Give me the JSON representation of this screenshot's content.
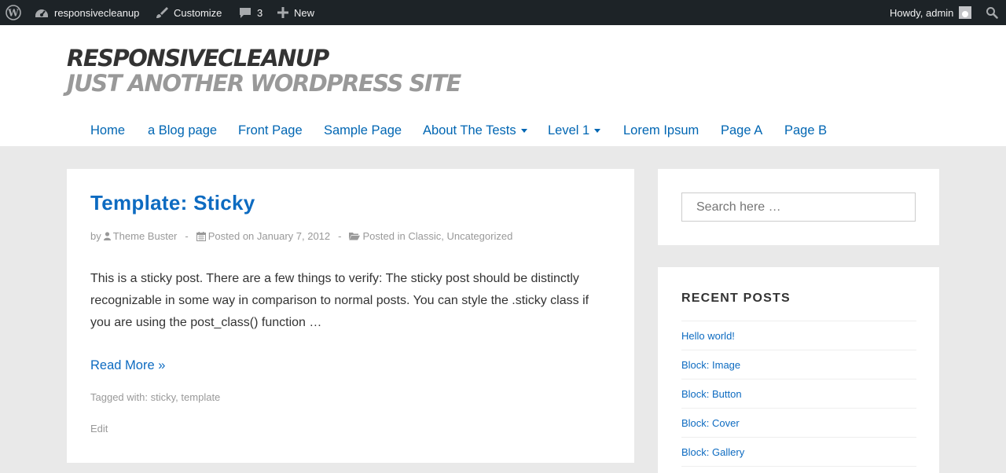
{
  "admin_bar": {
    "site_name": "responsivecleanup",
    "customize_label": "Customize",
    "comments_count": "3",
    "new_label": "New",
    "howdy": "Howdy, admin",
    "icons": [
      "wordpress-icon",
      "dashboard-icon",
      "brush-icon",
      "comment-icon",
      "plus-icon",
      "avatar",
      "search-icon"
    ]
  },
  "header": {
    "site_title": "RESPONSIVECLEANUP",
    "site_description": "JUST ANOTHER WORDPRESS SITE"
  },
  "nav": {
    "items": [
      {
        "label": "Home"
      },
      {
        "label": "a Blog page"
      },
      {
        "label": "Front Page"
      },
      {
        "label": "Sample Page"
      },
      {
        "label": "About The Tests",
        "has_dropdown": true
      },
      {
        "label": "Level 1",
        "has_dropdown": true
      },
      {
        "label": "Lorem Ipsum"
      },
      {
        "label": "Page A"
      },
      {
        "label": "Page B"
      }
    ]
  },
  "post": {
    "title": "Template: Sticky",
    "by": "by",
    "author": "Theme Buster",
    "posted_on": "Posted on",
    "date": "January 7, 2012",
    "posted_in": "Posted in",
    "category_1": "Classic",
    "category_sep": ",",
    "category_2": "Uncategorized",
    "excerpt": "This is a sticky post. There are a few things to verify: The sticky post should be distinctly recognizable in some way in comparison to normal posts. You can style the .sticky class if you are using the post_class() function …",
    "read_more": "Read More »",
    "tagged_with": "Tagged with:",
    "tag_1": "sticky",
    "tag_sep": ",",
    "tag_2": "template",
    "edit": "Edit",
    "meta_sep": "-"
  },
  "sidebar": {
    "search_placeholder": "Search here …",
    "recent_title": "RECENT POSTS",
    "recent_posts": [
      {
        "label": "Hello world!"
      },
      {
        "label": "Block: Image"
      },
      {
        "label": "Block: Button"
      },
      {
        "label": "Block: Cover"
      },
      {
        "label": "Block: Gallery"
      }
    ]
  },
  "colors": {
    "admin_bar_bg": "#1d2327",
    "link_blue": "#0d6bc1",
    "nav_blue": "#0066b3",
    "page_bg": "#e9e9e9"
  }
}
